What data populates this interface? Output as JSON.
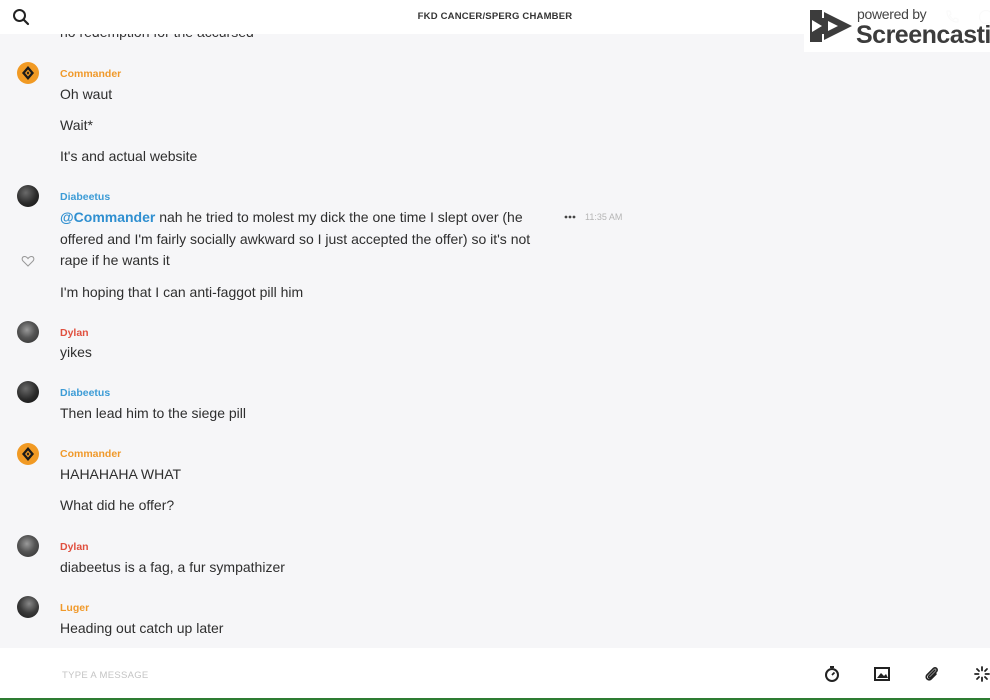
{
  "header": {
    "title": "FKD CANCER/SPERG CHAMBER",
    "icons": [
      "search-icon",
      "phone-icon",
      "info-icon"
    ]
  },
  "watermark": {
    "line1": "powered by",
    "brand": "Screencastify"
  },
  "messages": {
    "cut_off_text": "no redemption for the accursed",
    "g1": {
      "author": "Commander",
      "lines": [
        "Oh waut",
        "Wait*",
        "It's and actual website"
      ]
    },
    "g2": {
      "author": "Diabeetus",
      "mention": "@Commander",
      "line1": " nah he tried to molest my dick the one time I slept over (he offered and I'm fairly socially awkward so I just accepted the offer) so it's not rape if he wants it",
      "line2": "I'm hoping that I can anti-faggot pill him",
      "timestamp": "11:35 AM"
    },
    "g3": {
      "author": "Dylan",
      "lines": [
        "yikes"
      ]
    },
    "g4": {
      "author": "Diabeetus",
      "lines": [
        "Then lead him to the siege pill"
      ]
    },
    "g5": {
      "author": "Commander",
      "lines": [
        "HAHAHAHA WHAT",
        "What did he offer?"
      ]
    },
    "g6": {
      "author": "Dylan",
      "lines": [
        "diabeetus is a fag, a fur sympathizer"
      ]
    },
    "g7": {
      "author": "Luger",
      "lines": [
        "Heading out catch up later"
      ]
    }
  },
  "composer": {
    "placeholder": "TYPE A MESSAGE",
    "value": "",
    "tools": [
      "timer-icon",
      "image-icon",
      "paperclip-icon",
      "sparkle-icon"
    ]
  },
  "colors": {
    "commander": "#f0992a",
    "diabeetus": "#3d9cd6",
    "dylan": "#e0503f",
    "luger": "#f0992a",
    "mention": "#2f8fd0",
    "background": "#f6f6f8"
  }
}
